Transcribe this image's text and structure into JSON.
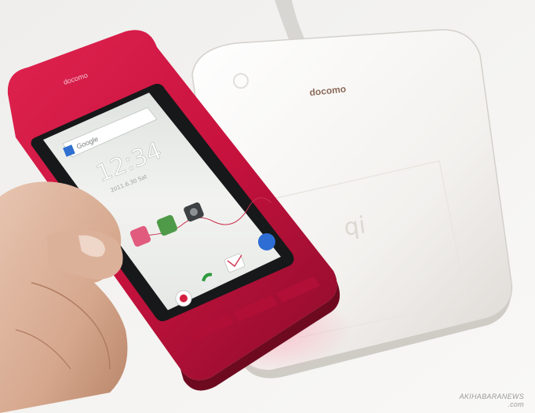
{
  "photo": {
    "charger_brand": "docomo",
    "phone_brand": "docomo",
    "qi_logo": "qi",
    "watermark_line1": "AKIHABARANEWS",
    "watermark_line2": ".com"
  },
  "phone_screen": {
    "search_label": "Google",
    "clock_time": "12:34",
    "clock_date": "2011.6.30 Sat",
    "apps": [
      "app-icon-1",
      "app-icon-2",
      "camera-icon",
      "browser-icon",
      "mail-icon",
      "phone-icon"
    ]
  },
  "colors": {
    "phone_body": "#c8123e",
    "phone_dark": "#7a0a22",
    "charger": "#f7f5f2",
    "screen_bg": "#eef0ee"
  }
}
